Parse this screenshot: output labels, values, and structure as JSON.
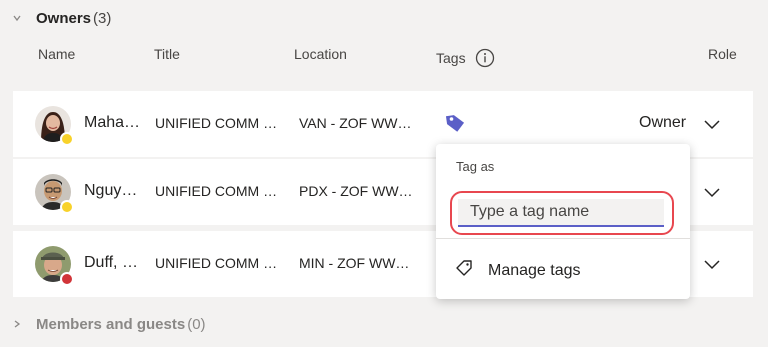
{
  "owners": {
    "title": "Owners",
    "count": "(3)"
  },
  "columns": {
    "name": "Name",
    "title": "Title",
    "location": "Location",
    "tags": "Tags",
    "role": "Role"
  },
  "rows": [
    {
      "name": "Maha…",
      "title": "UNIFIED COMM …",
      "location": "VAN - ZOF WW…",
      "role": "Owner",
      "status": "away"
    },
    {
      "name": "Nguy…",
      "title": "UNIFIED COMM …",
      "location": "PDX - ZOF WW…",
      "role": "",
      "status": "away"
    },
    {
      "name": "Duff, …",
      "title": "UNIFIED COMM …",
      "location": "MIN - ZOF WW…",
      "role": "",
      "status": "busy"
    }
  ],
  "popup": {
    "tag_as": "Tag as",
    "input_placeholder": "Type a tag name",
    "manage_tags": "Manage tags"
  },
  "members": {
    "title": "Members and guests",
    "count": "(0)"
  },
  "colors": {
    "accent": "#5b5fc7",
    "highlight": "#e8474f",
    "away": "#f8d22a",
    "busy": "#d13438"
  },
  "icons": {
    "tag": "tag-icon",
    "info": "info-icon",
    "chevron": "chevron-down-icon"
  }
}
